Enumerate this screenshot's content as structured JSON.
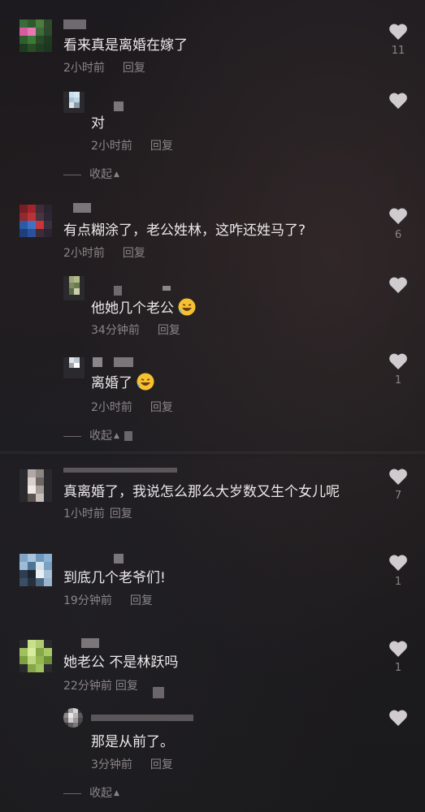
{
  "colors": {
    "text_primary": "#ece8ea",
    "text_secondary": "#8a8588",
    "heart": "#cfcbce"
  },
  "comments": [
    {
      "text": "看来真是离婚在嫁了",
      "time": "2小时前",
      "reply": "回复",
      "likes": "11"
    },
    {
      "text": "对",
      "time": "2小时前",
      "reply": "回复"
    },
    {
      "text": "有点糊涂了，老公姓林，这咋还姓马了?",
      "time": "2小时前",
      "reply": "回复",
      "likes": "6"
    },
    {
      "text": "他她几个老公",
      "time": "34分钟前",
      "reply": "回复",
      "emoji": "rofl-emoji"
    },
    {
      "text": "离婚了",
      "time": "2小时前",
      "reply": "回复",
      "likes": "1",
      "emoji": "rofl-emoji"
    },
    {
      "text": "真离婚了，我说怎么那么大岁数又生个女儿呢",
      "time": "1小时前",
      "reply": "回复",
      "likes": "7"
    },
    {
      "text": "到底几个老爷们!",
      "time": "19分钟前",
      "reply": "回复",
      "likes": "1"
    },
    {
      "text": "她老公 不是林跃吗",
      "time": "22分钟前",
      "reply": "回复",
      "likes": "1"
    },
    {
      "text": "那是从前了。",
      "time": "3分钟前",
      "reply": "回复"
    }
  ],
  "collapse_label": "收起",
  "icons": {
    "like": "heart-icon",
    "collapse": "triangle-up-icon"
  }
}
